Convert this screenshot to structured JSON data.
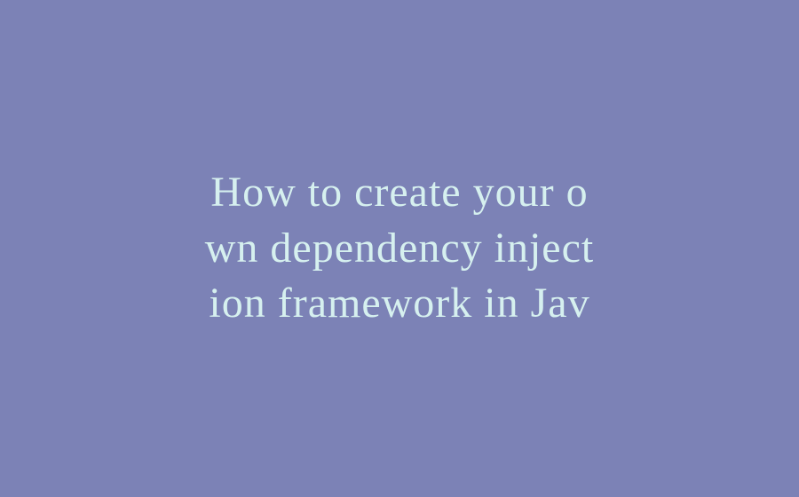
{
  "title": {
    "line1": "How to create your o",
    "line2": "wn dependency inject",
    "line3": "ion framework in Jav"
  }
}
